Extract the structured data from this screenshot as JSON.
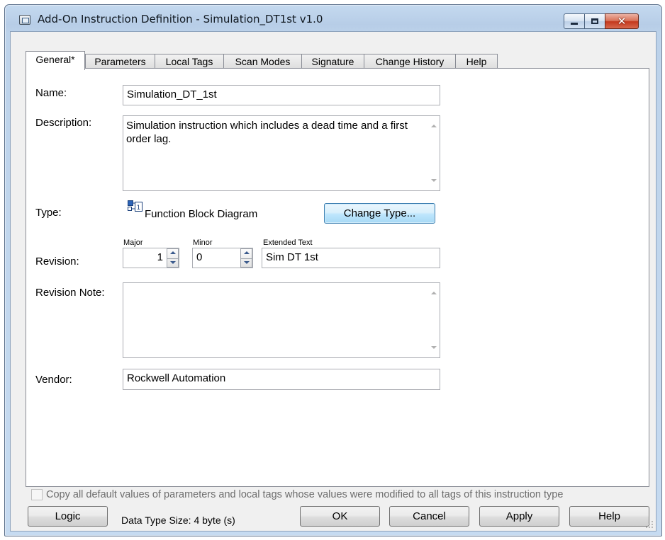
{
  "window": {
    "title": "Add-On Instruction Definition - Simulation_DT1st v1.0"
  },
  "tabs": [
    {
      "label": "General*"
    },
    {
      "label": "Parameters"
    },
    {
      "label": "Local Tags"
    },
    {
      "label": "Scan Modes"
    },
    {
      "label": "Signature"
    },
    {
      "label": "Change History"
    },
    {
      "label": "Help"
    }
  ],
  "general": {
    "name_label": "Name:",
    "name_value": "Simulation_DT_1st",
    "description_label": "Description:",
    "description_value": "Simulation instruction which includes a dead time and a first order lag.",
    "type_label": "Type:",
    "type_value": "Function Block Diagram",
    "change_type_label": "Change Type...",
    "revision_label": "Revision:",
    "major_label": "Major",
    "major_value": "1",
    "minor_label": "Minor",
    "minor_value": "0",
    "extended_text_label": "Extended Text",
    "extended_text_value": "Sim DT 1st",
    "revision_note_label": "Revision Note:",
    "revision_note_value": "",
    "vendor_label": "Vendor:",
    "vendor_value": "Rockwell Automation"
  },
  "footer": {
    "copy_defaults_label": "Copy all default values of parameters and local tags whose values were modified to all tags of this instruction type",
    "copy_defaults_checked": false,
    "logic_label": "Logic",
    "data_type_size": "Data Type Size: 4 byte (s)",
    "ok_label": "OK",
    "cancel_label": "Cancel",
    "apply_label": "Apply",
    "help_label": "Help"
  },
  "icons": {
    "window": "instruction-definition-icon",
    "type": "function-block-diagram-icon",
    "minimize": "minimize-icon",
    "maximize": "maximize-icon",
    "close": "close-icon"
  },
  "colors": {
    "frame": "#bcd2ea",
    "close_button": "#c3371c",
    "focused_button": "#bee6fd"
  }
}
